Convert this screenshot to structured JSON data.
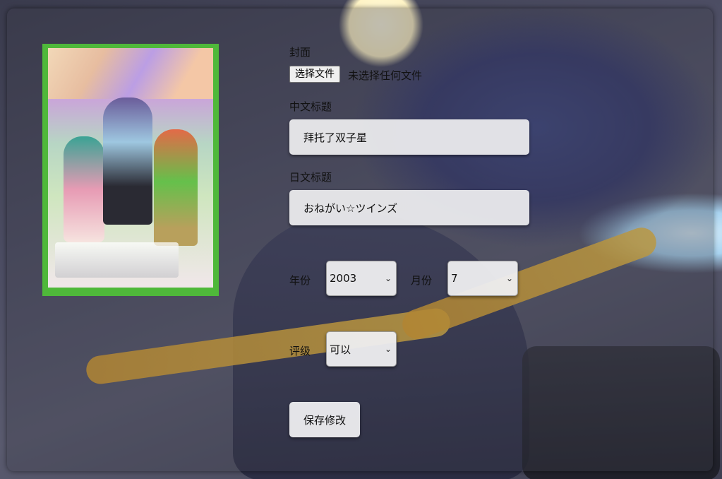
{
  "form": {
    "cover_label": "封面",
    "file_button_label": "选择文件",
    "file_status": "未选择任何文件",
    "cn_title_label": "中文标题",
    "cn_title_value": "拜托了双子星",
    "jp_title_label": "日文标题",
    "jp_title_value": "おねがい☆ツインズ",
    "year_label": "年份",
    "year_value": "2003",
    "month_label": "月份",
    "month_value": "7",
    "rating_label": "评级",
    "rating_value": "可以",
    "save_label": "保存修改"
  },
  "icons": {
    "dropdown": "chevron-down-icon"
  },
  "colors": {
    "cover_frame": "#4fb83a",
    "input_bg": "#eeeef0"
  }
}
